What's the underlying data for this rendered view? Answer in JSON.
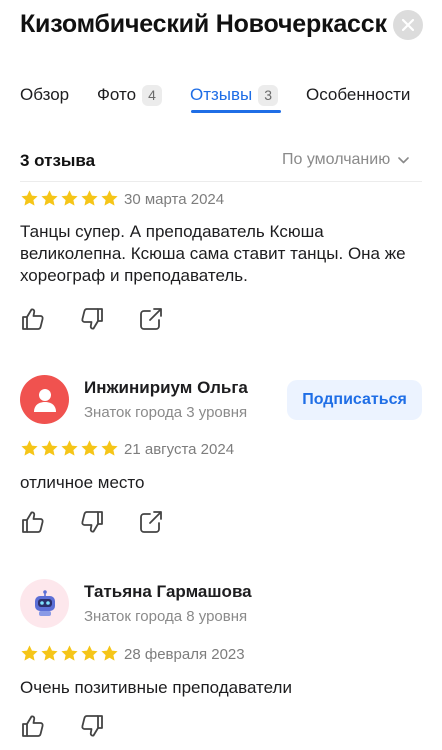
{
  "header": {
    "title": "Кизомбический Новочеркасск"
  },
  "tabs": [
    {
      "label": "Обзор",
      "count": ""
    },
    {
      "label": "Фото",
      "count": "4"
    },
    {
      "label": "Отзывы",
      "count": "3"
    },
    {
      "label": "Особенности",
      "count": ""
    }
  ],
  "active_tab": "Отзывы",
  "reviews_header": {
    "count_label": "3 отзыва",
    "sort_label": "По умолчанию"
  },
  "colors": {
    "accent": "#1f6ee6",
    "star": "#f5c518",
    "avatar_red": "#f0524f"
  },
  "reviews": [
    {
      "rating": 5,
      "date": "30 марта 2024",
      "text": "Танцы супер. А преподаватель Ксюша великолепна.  Ксюша сама ставит танцы. Она же хореограф и преподаватель."
    },
    {
      "author": "Инжинириум Ольга",
      "level": "Знаток города 3 уровня",
      "subscribe_label": "Подписаться",
      "avatar_icon": "person-icon",
      "rating": 5,
      "date": "21 августа 2024",
      "text": "отличное место"
    },
    {
      "author": "Татьяна Гармашова",
      "level": "Знаток города 8 уровня",
      "avatar_icon": "robot-icon",
      "rating": 5,
      "date": "28 февраля 2023",
      "text": "Очень позитивные преподаватели"
    }
  ]
}
